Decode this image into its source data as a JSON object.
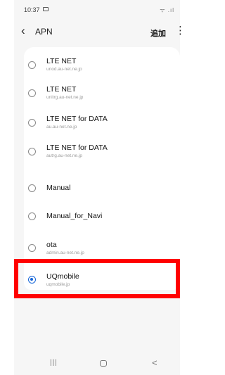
{
  "status_bar": {
    "time": "10:37",
    "signal_text": "ᯤ .ıl"
  },
  "app_bar": {
    "back_symbol": "‹",
    "title": "APN",
    "add_label": "追加",
    "more_symbol": "⋮"
  },
  "apn_list": [
    {
      "name": "LTE NET",
      "apn": "unod.au-net.ne.jp",
      "selected": false
    },
    {
      "name": "LTE NET",
      "apn": "unitrg.au-net.ne.jp",
      "selected": false
    },
    {
      "name": "LTE NET for DATA",
      "apn": "au.au-net.ne.jp",
      "selected": false
    },
    {
      "name": "LTE NET for DATA",
      "apn": "autrg.au-net.ne.jp",
      "selected": false
    },
    {
      "name": "Manual",
      "apn": "",
      "selected": false
    },
    {
      "name": "Manual_for_Navi",
      "apn": "",
      "selected": false
    },
    {
      "name": "ota",
      "apn": "admin.au-net.ne.jp",
      "selected": false
    },
    {
      "name": "UQmobile",
      "apn": "uqmobile.jp",
      "selected": true
    }
  ],
  "colors": {
    "selected_radio": "#1565d8",
    "highlight": "#ff0000",
    "background": "#f6f6f6"
  },
  "nav_bar": {
    "recents_symbol": "|||",
    "back_symbol": "<"
  }
}
